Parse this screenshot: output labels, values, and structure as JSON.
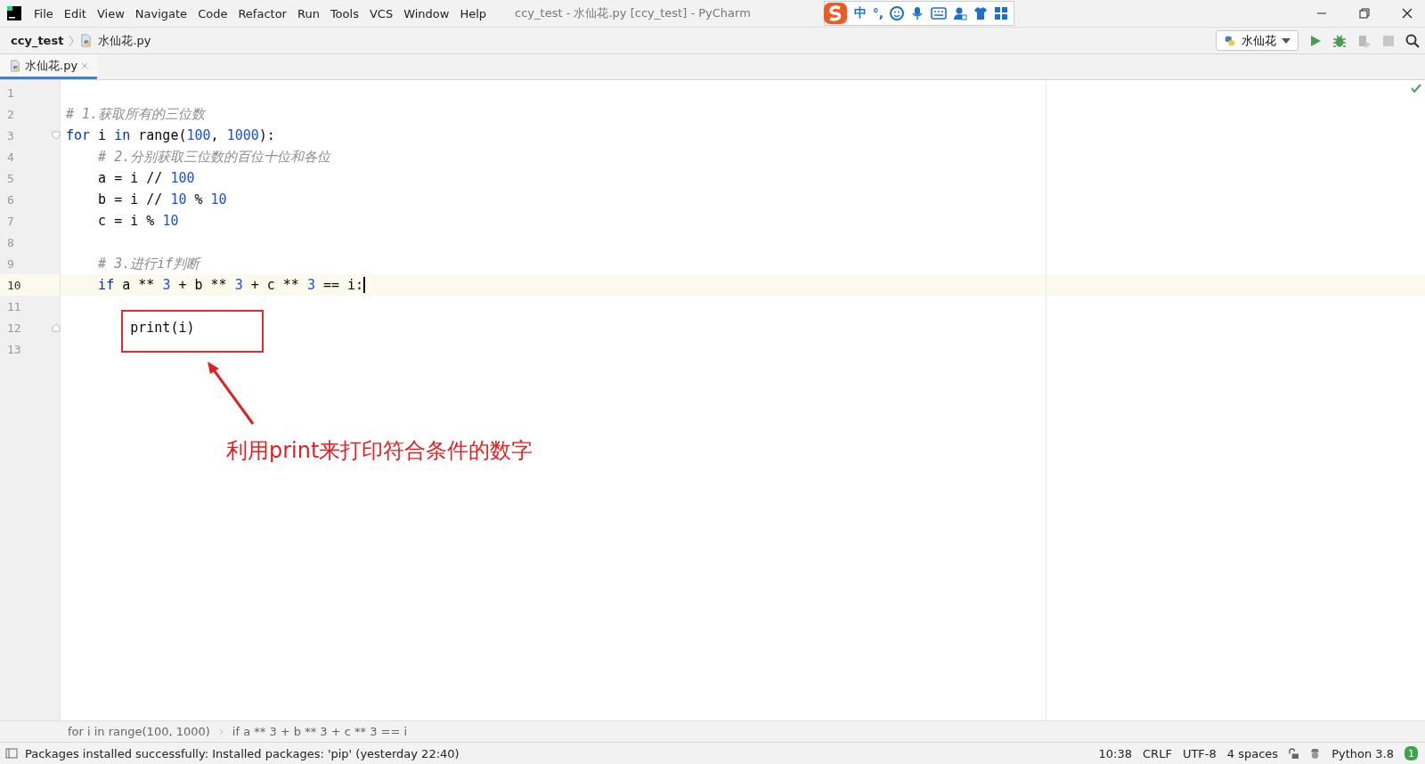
{
  "window": {
    "title": "ccy_test - 水仙花.py [ccy_test] - PyCharm"
  },
  "menu": [
    "File",
    "Edit",
    "View",
    "Navigate",
    "Code",
    "Refactor",
    "Run",
    "Tools",
    "VCS",
    "Window",
    "Help"
  ],
  "ime_toolbar": {
    "items": [
      "中",
      "°,"
    ]
  },
  "breadcrumb": {
    "project": "ccy_test",
    "file": "水仙花.py"
  },
  "run_config": {
    "label": "水仙花"
  },
  "tabs": [
    {
      "label": "水仙花.py",
      "selected": true
    }
  ],
  "editor": {
    "lines": [
      {
        "number": "1"
      },
      {
        "number": "2",
        "tokens": [
          {
            "kind": "comment",
            "text": "# 1.获取所有的三位数"
          }
        ]
      },
      {
        "number": "3",
        "fold_start": true,
        "tokens": [
          {
            "kind": "keyword",
            "text": "for"
          },
          {
            "kind": "plain",
            "text": " i "
          },
          {
            "kind": "keyword",
            "text": "in"
          },
          {
            "kind": "plain",
            "text": " range("
          },
          {
            "kind": "number",
            "text": "100"
          },
          {
            "kind": "plain",
            "text": ", "
          },
          {
            "kind": "number",
            "text": "1000"
          },
          {
            "kind": "plain",
            "text": "):"
          }
        ]
      },
      {
        "number": "4",
        "tokens": [
          {
            "kind": "comment",
            "text": "    # 2.分别获取三位数的百位十位和各位"
          }
        ]
      },
      {
        "number": "5",
        "tokens": [
          {
            "kind": "plain",
            "text": "    a = i // "
          },
          {
            "kind": "number",
            "text": "100"
          }
        ]
      },
      {
        "number": "6",
        "tokens": [
          {
            "kind": "plain",
            "text": "    b = i // "
          },
          {
            "kind": "number",
            "text": "10"
          },
          {
            "kind": "plain",
            "text": " % "
          },
          {
            "kind": "number",
            "text": "10"
          }
        ]
      },
      {
        "number": "7",
        "tokens": [
          {
            "kind": "plain",
            "text": "    c = i % "
          },
          {
            "kind": "number",
            "text": "10"
          }
        ]
      },
      {
        "number": "8"
      },
      {
        "number": "9",
        "tokens": [
          {
            "kind": "comment",
            "text": "    # 3.进行if判断"
          }
        ]
      },
      {
        "number": "10",
        "current": true,
        "tokens": [
          {
            "kind": "keyword",
            "text": "    if"
          },
          {
            "kind": "plain",
            "text": " a ** "
          },
          {
            "kind": "number",
            "text": "3"
          },
          {
            "kind": "plain",
            "text": " + b ** "
          },
          {
            "kind": "number",
            "text": "3"
          },
          {
            "kind": "plain",
            "text": " + c ** "
          },
          {
            "kind": "number",
            "text": "3"
          },
          {
            "kind": "plain",
            "text": " == i:"
          }
        ]
      },
      {
        "number": "11"
      },
      {
        "number": "12",
        "fold_end": true,
        "tokens": [
          {
            "kind": "plain",
            "text": "        print(i)"
          }
        ]
      },
      {
        "number": "13"
      }
    ]
  },
  "annotation": {
    "caption": "利用print来打印符合条件的数字"
  },
  "code_breadcrumbs": [
    "for i in range(100, 1000)",
    "if a ** 3 + b ** 3 + c ** 3 == i"
  ],
  "status_bar": {
    "message": "Packages installed successfully: Installed packages: 'pip' (yesterday 22:40)",
    "items": [
      "10:38",
      "CRLF",
      "UTF-8",
      "4 spaces"
    ],
    "interpreter": "Python 3.8",
    "notification_count": "1"
  }
}
